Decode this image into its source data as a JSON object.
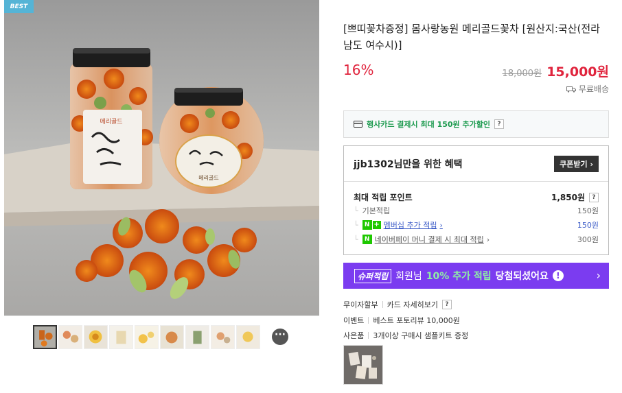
{
  "badge": "BEST",
  "product": {
    "title": "[쁘띠꽃차증정] 몸사랑농원 메리골드꽃차 [원산지:국산(전라남도 여수시)]",
    "discount": "16%",
    "original_price": "18,000원",
    "price": "15,000원",
    "shipping": "무료배송"
  },
  "jar_labels": {
    "big": "메리골드",
    "small": "메리골드"
  },
  "card_benefit": {
    "text": "행사카드 결제시 최대 150원 추가할인",
    "help": "?"
  },
  "benefit": {
    "title": "jjb1302님만을 위한 혜택",
    "coupon_button": "쿠폰받기",
    "max_points_label": "최대 적립 포인트",
    "max_points_value": "1,850원",
    "help": "?",
    "rows": [
      {
        "label": "기본적립",
        "value": "150원"
      },
      {
        "label": "멤버십 추가 적립",
        "value": "150원"
      },
      {
        "label": "네이버페이 머니 결제 시 최대 적립",
        "value": "300원"
      }
    ],
    "badges": {
      "n": "N",
      "plus": "+",
      "npay": "N"
    }
  },
  "super_banner": {
    "tag": "슈퍼적립",
    "text_pre": "회원님",
    "highlight": "10% 추가 적립",
    "text_post": "당첨되셨어요",
    "alert": "!",
    "arrow": "›"
  },
  "info": {
    "installment_label": "무이자할부",
    "installment_link": "카드 자세히보기",
    "help": "?",
    "event_label": "이벤트",
    "event_value": "베스트 포토리뷰 10,000원",
    "gift_label": "사은품",
    "gift_value": "3개이상 구매시 샘플키트 증정"
  },
  "more_button": "···",
  "colors": {
    "accent_red": "#e0243d",
    "super_purple": "#7b3cf0",
    "naver_green": "#1ec800",
    "best_blue": "#55b4d6"
  }
}
